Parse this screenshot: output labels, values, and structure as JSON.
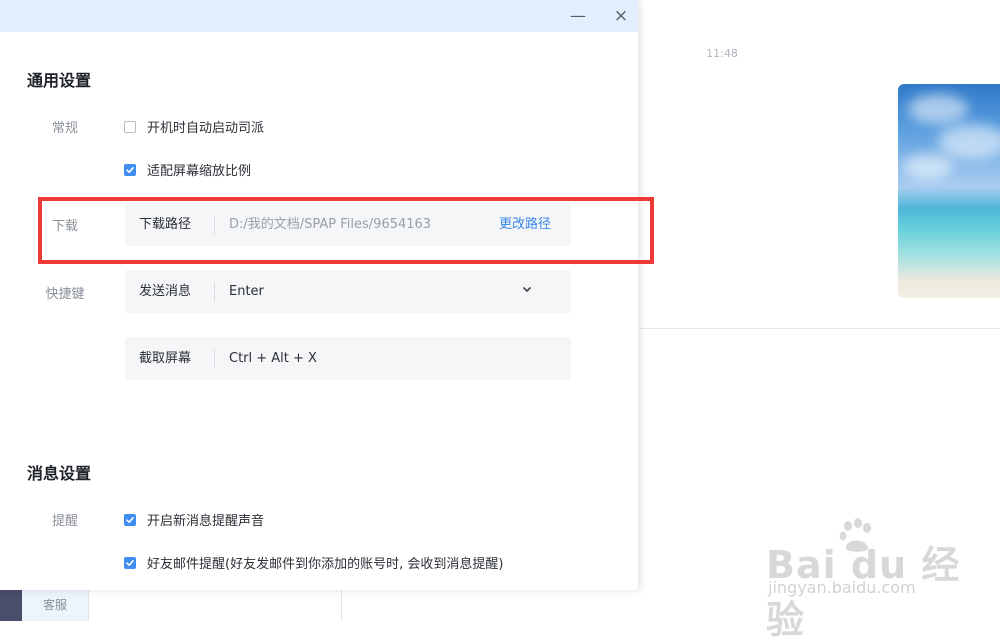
{
  "window": {
    "minimize_symbol": "—",
    "close_symbol": "×"
  },
  "general_settings": {
    "title": "通用设置",
    "general_label": "常规",
    "auto_start": {
      "label": "开机时自动启动司派",
      "checked": false
    },
    "screen_scale": {
      "label": "适配屏幕缩放比例",
      "checked": true
    },
    "download_label": "下载",
    "download_path": {
      "label": "下载路径",
      "value": "D:/我的文档/SPAP Files/9654163",
      "action": "更改路径"
    },
    "shortcuts_label": "快捷键",
    "send_message": {
      "label": "发送消息",
      "value": "Enter"
    },
    "screenshot": {
      "label": "截取屏幕",
      "value": "Ctrl + Alt + X"
    }
  },
  "message_settings": {
    "title": "消息设置",
    "remind_label": "提醒",
    "new_message_sound": {
      "label": "开启新消息提醒声音",
      "checked": true
    },
    "friend_mail_remind": {
      "label": "好友邮件提醒(好友发邮件到你添加的账号时, 会收到消息提醒)",
      "checked": true
    }
  },
  "chat": {
    "timestamp": "11:48"
  },
  "sidebar": {
    "service_tab": "客服"
  },
  "watermark": {
    "brand": "Bai du 经验",
    "url": "jingyan.baidu.com"
  },
  "colors": {
    "accent": "#3f8df0",
    "link": "#3a86e8",
    "highlight_box": "#ee3a37",
    "titlebar": "#e3effc"
  }
}
